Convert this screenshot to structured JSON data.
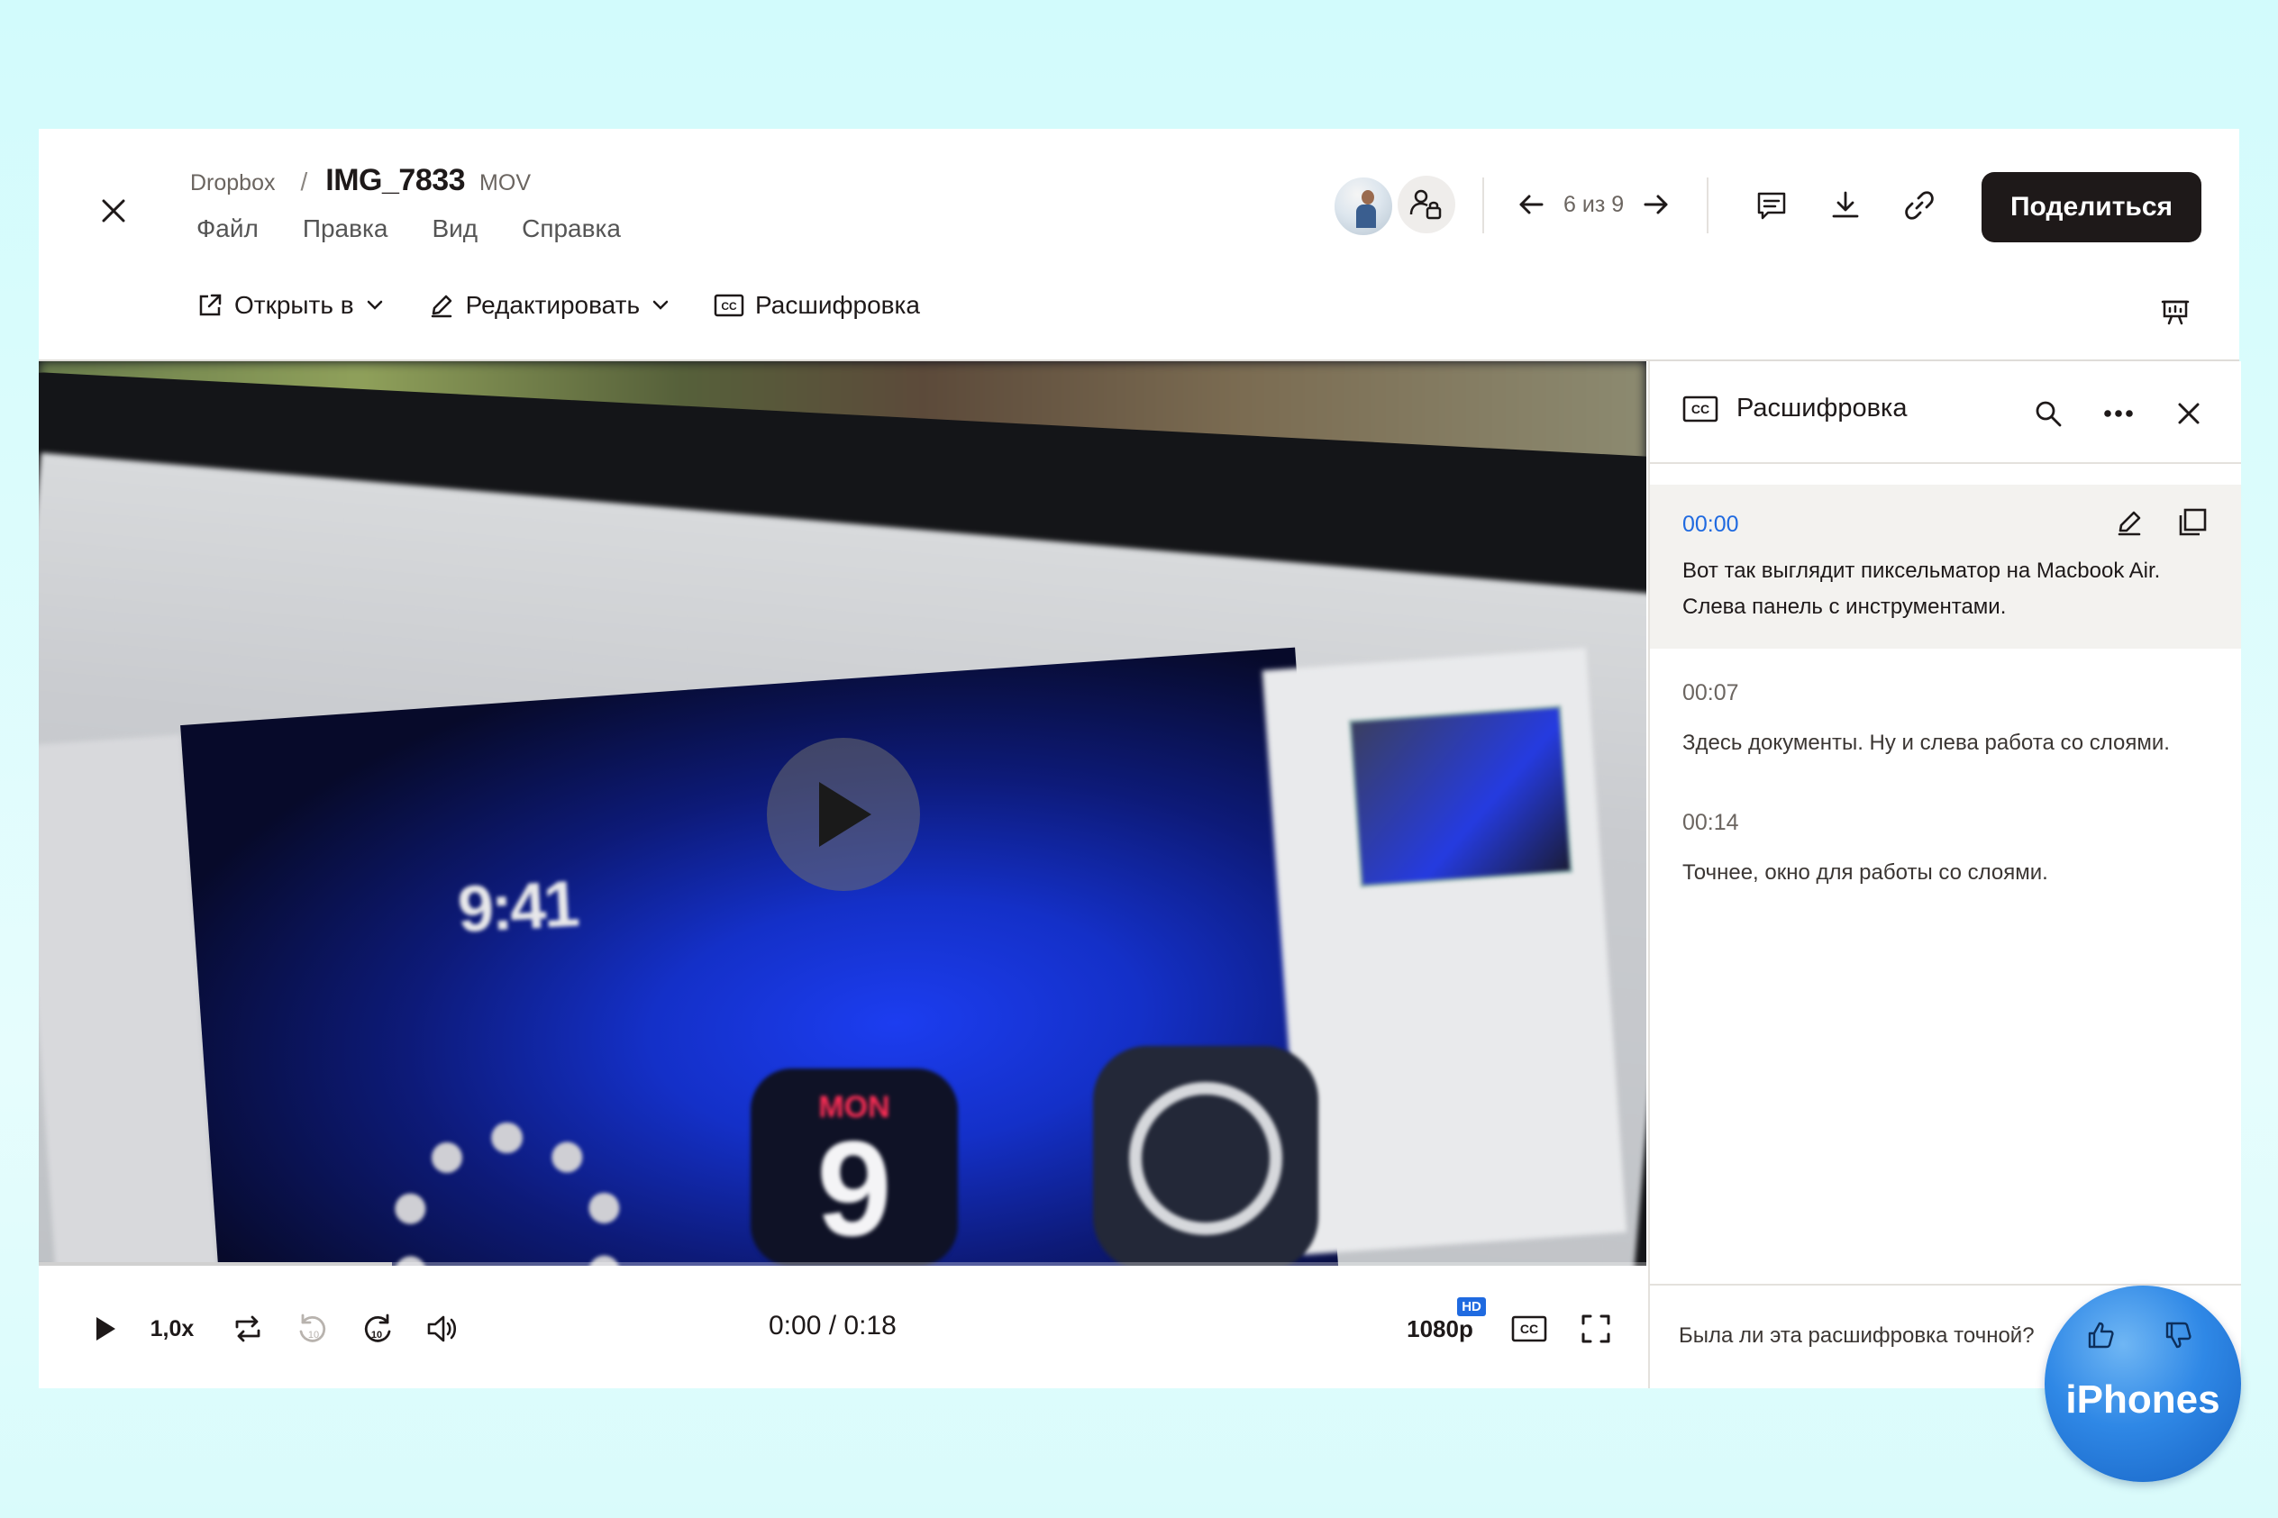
{
  "header": {
    "breadcrumb_root": "Dropbox",
    "breadcrumb_sep": "/",
    "file_name": "IMG_7833",
    "file_ext": "MOV",
    "menu": [
      "Файл",
      "Правка",
      "Вид",
      "Справка"
    ],
    "pager": "6 из 9",
    "share_label": "Поделиться"
  },
  "toolbar": {
    "open_in": "Открыть в",
    "edit": "Редактировать",
    "transcript": "Расшифровка"
  },
  "video": {
    "screen_time": "9:41",
    "calendar_month": "MON",
    "calendar_day": "9",
    "progress_fraction": 0.22
  },
  "controls": {
    "speed": "1,0x",
    "skip_back": "10",
    "skip_forward": "10",
    "timecode": "0:00 / 0:18",
    "quality": "1080p",
    "quality_badge": "HD"
  },
  "transcript": {
    "title": "Расшифровка",
    "segments": [
      {
        "time": "00:00",
        "text": "Вот так выглядит пиксельматор на Macbook Air. Слева панель с инструментами."
      },
      {
        "time": "00:07",
        "text": "Здесь документы. Ну и слева работа со слоями."
      },
      {
        "time": "00:14",
        "text": "Точнее, окно для работы со слоями."
      }
    ],
    "feedback_question": "Была ли эта расшифровка точной?"
  },
  "watermark": "iPhones",
  "colors": {
    "accent": "#1f6ae0",
    "primary_button": "#1e1919",
    "page_background": "#d6fbfb"
  }
}
